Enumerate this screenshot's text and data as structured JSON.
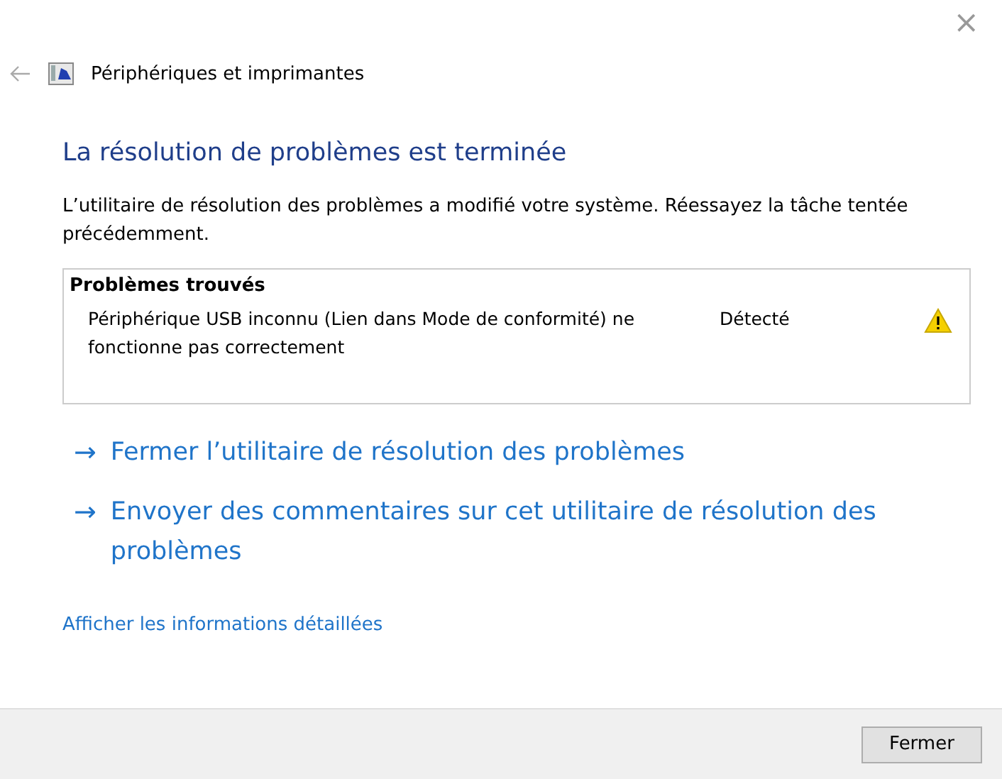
{
  "window": {
    "title": "Périphériques et imprimantes",
    "close": "×"
  },
  "heading": "La résolution de problèmes est terminée",
  "description": "L’utilitaire de résolution des problèmes a modifié votre système. Réessayez la tâche tentée précédemment.",
  "problems": {
    "title": "Problèmes trouvés",
    "rows": [
      {
        "name": "Périphérique USB inconnu (Lien dans Mode de conformité) ne fonctionne pas correctement",
        "status": "Détecté",
        "kind": "warning"
      }
    ]
  },
  "actions": [
    {
      "arrow": "→",
      "label": "Fermer l’utilitaire de résolution des problèmes"
    },
    {
      "arrow": "→",
      "label": "Envoyer des commentaires sur cet utilitaire de résolution des problèmes"
    }
  ],
  "details_link": "Afficher les informations détaillées",
  "buttons": [
    "Fermer"
  ]
}
